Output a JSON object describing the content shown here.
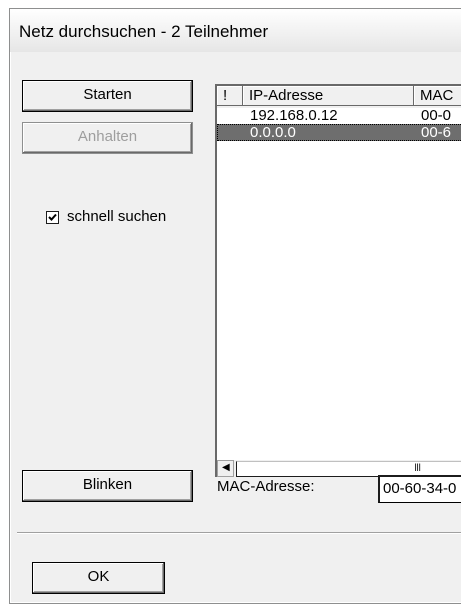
{
  "window": {
    "title": "Netz durchsuchen - 2 Teilnehmer"
  },
  "buttons": {
    "start_label": "Starten",
    "stop_label": "Anhalten",
    "blink_label": "Blinken",
    "ok_label": "OK"
  },
  "options": {
    "fast_search_label": "schnell suchen",
    "fast_search_checked": true
  },
  "table": {
    "columns": [
      "!",
      "IP-Adresse",
      "MAC"
    ],
    "rows": [
      {
        "flag": "",
        "ip": "192.168.0.12",
        "mac": "00-0",
        "selected": false
      },
      {
        "flag": "",
        "ip": "0.0.0.0",
        "mac": "00-6",
        "selected": true
      }
    ],
    "scroll_grip": "III"
  },
  "mac_field": {
    "label": "MAC-Adresse:",
    "value": "00-60-34-0"
  },
  "icons": {
    "checkbox": "checkmark-icon",
    "scroll_left": "arrow-left-icon"
  },
  "colors": {
    "selected_row": "#6e6e6e",
    "dialog_bg": "#f0f0f0"
  }
}
